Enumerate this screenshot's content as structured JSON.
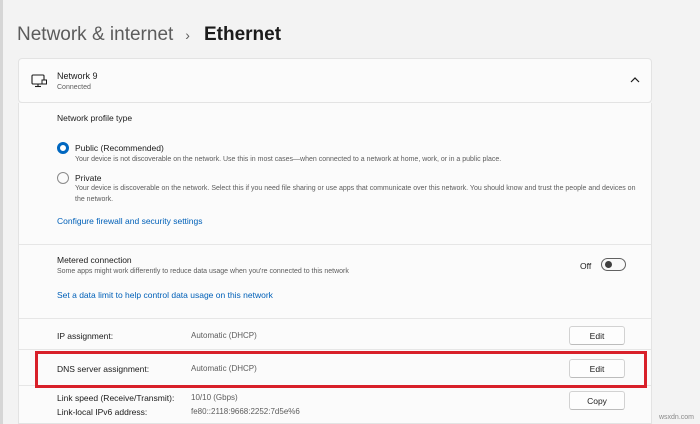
{
  "breadcrumb": {
    "parent": "Network & internet",
    "separator": "›",
    "current": "Ethernet"
  },
  "network": {
    "icon": "ethernet-monitor-icon",
    "name": "Network 9",
    "status": "Connected"
  },
  "profile": {
    "section_title": "Network profile type",
    "selected": "public",
    "options": [
      {
        "id": "public",
        "title": "Public (Recommended)",
        "description": "Your device is not discoverable on the network. Use this in most cases—when connected to a network at home, work, or in a public place."
      },
      {
        "id": "private",
        "title": "Private",
        "description": "Your device is discoverable on the network. Select this if you need file sharing or use apps that communicate over this network. You should know and trust the people and devices on the network."
      }
    ],
    "firewall_link": "Configure firewall and security settings"
  },
  "metered": {
    "title": "Metered connection",
    "description": "Some apps might work differently to reduce data usage when you're connected to this network",
    "toggle_state": "Off",
    "data_limit_link": "Set a data limit to help control data usage on this network"
  },
  "properties": {
    "ip_assignment": {
      "label": "IP assignment:",
      "value": "Automatic (DHCP)",
      "button": "Edit"
    },
    "dns_assignment": {
      "label": "DNS server assignment:",
      "value": "Automatic (DHCP)",
      "button": "Edit"
    },
    "link_speed": {
      "label": "Link speed (Receive/Transmit):",
      "value": "10/10 (Gbps)",
      "button": "Copy"
    },
    "ipv6": {
      "label": "Link-local IPv6 address:",
      "value": "fe80::2118:9668:2252:7d5e%6"
    }
  },
  "colors": {
    "accent": "#0067c0",
    "link": "#0060b8",
    "highlight": "#d8202a"
  },
  "watermark": "wsxdn.com"
}
